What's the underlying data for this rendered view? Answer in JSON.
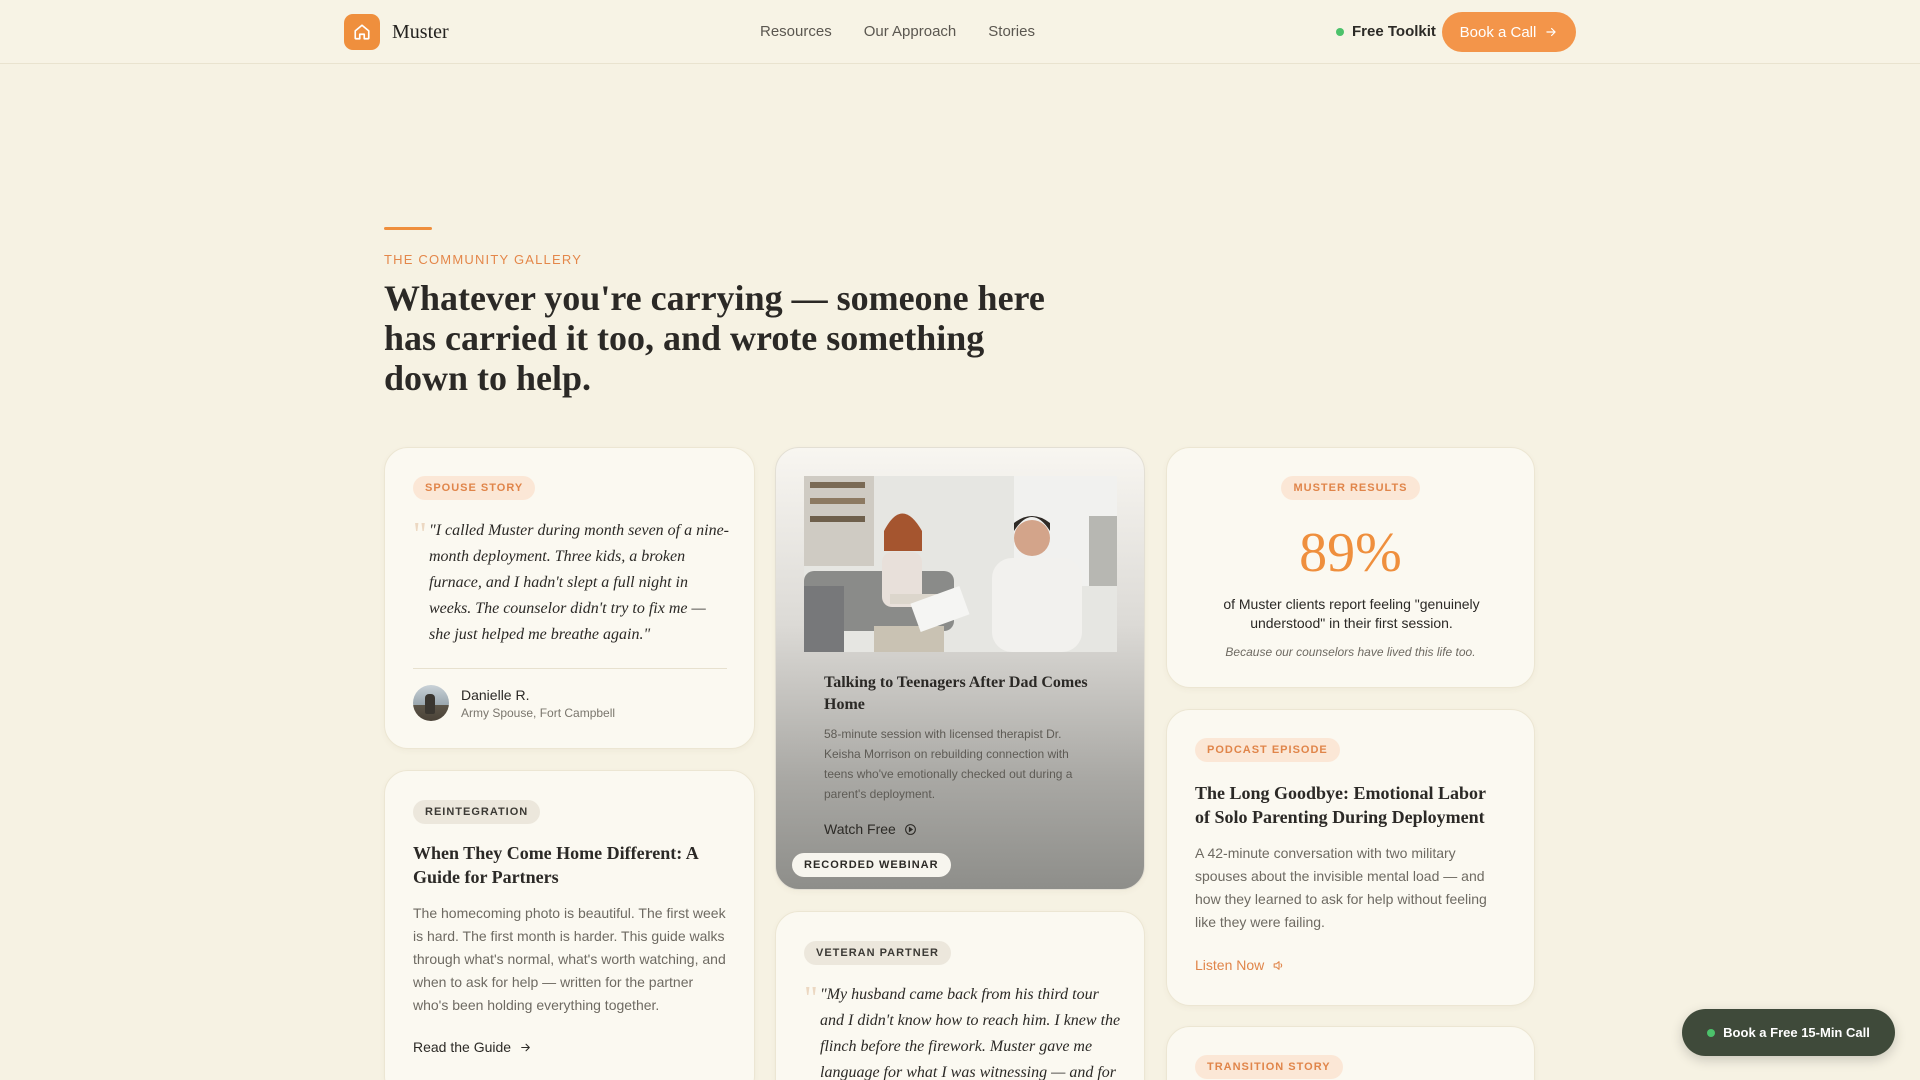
{
  "brand": {
    "name": "Muster"
  },
  "nav": {
    "items": [
      "Resources",
      "Our Approach",
      "Stories"
    ]
  },
  "header": {
    "toolkit_label": "Free Toolkit",
    "book_label": "Book a Call"
  },
  "hero": {
    "eyebrow": "THE COMMUNITY GALLERY",
    "title": "Whatever you're carrying — someone here has carried it too, and wrote something down to help."
  },
  "cards": {
    "spouse": {
      "tag": "SPOUSE STORY",
      "quote": "\"I called Muster during month seven of a nine-month deployment. Three kids, a broken furnace, and I hadn't slept a full night in weeks. The counselor didn't try to fix me — she just helped me breathe again.\"",
      "author": "Danielle R.",
      "author_meta": "Army Spouse, Fort Campbell"
    },
    "reintegration": {
      "tag": "REINTEGRATION",
      "title": "When They Come Home Different: A Guide for Partners",
      "body": "The homecoming photo is beautiful. The first week is hard. The first month is harder. This guide walks through what's normal, what's worth watching, and when to ask for help — written for the partner who's been holding everything together.",
      "link": "Read the Guide"
    },
    "webinar": {
      "title": "Talking to Teenagers After Dad Comes Home",
      "body": "58-minute session with licensed therapist Dr. Keisha Morrison on rebuilding connection with teens who've emotionally checked out during a parent's deployment.",
      "link": "Watch Free",
      "badge": "RECORDED WEBINAR"
    },
    "veteran": {
      "tag": "VETERAN PARTNER",
      "quote": "\"My husband came back from his third tour and I didn't know how to reach him. I knew the flinch before the firework. Muster gave me language for what I was witnessing — and for"
    },
    "results": {
      "tag": "MUSTER RESULTS",
      "stat": "89%",
      "stat_value": 89,
      "desc": "of Muster clients report feeling \"genuinely understood\" in their first session.",
      "note": "Because our counselors have lived this life too."
    },
    "podcast": {
      "tag": "PODCAST EPISODE",
      "title": "The Long Goodbye: Emotional Labor of Solo Parenting During Deployment",
      "body": "A 42-minute conversation with two military spouses about the invisible mental load — and how they learned to ask for help without feeling like they were failing.",
      "link": "Listen Now"
    },
    "transition": {
      "tag": "TRANSITION STORY"
    }
  },
  "floating_cta": {
    "label": "Book a Free 15-Min Call"
  },
  "colors": {
    "accent": "#ef8f3d",
    "background": "#f6f2e3",
    "cta_dark": "#3f4a3a",
    "status_green": "#4cc26b"
  }
}
